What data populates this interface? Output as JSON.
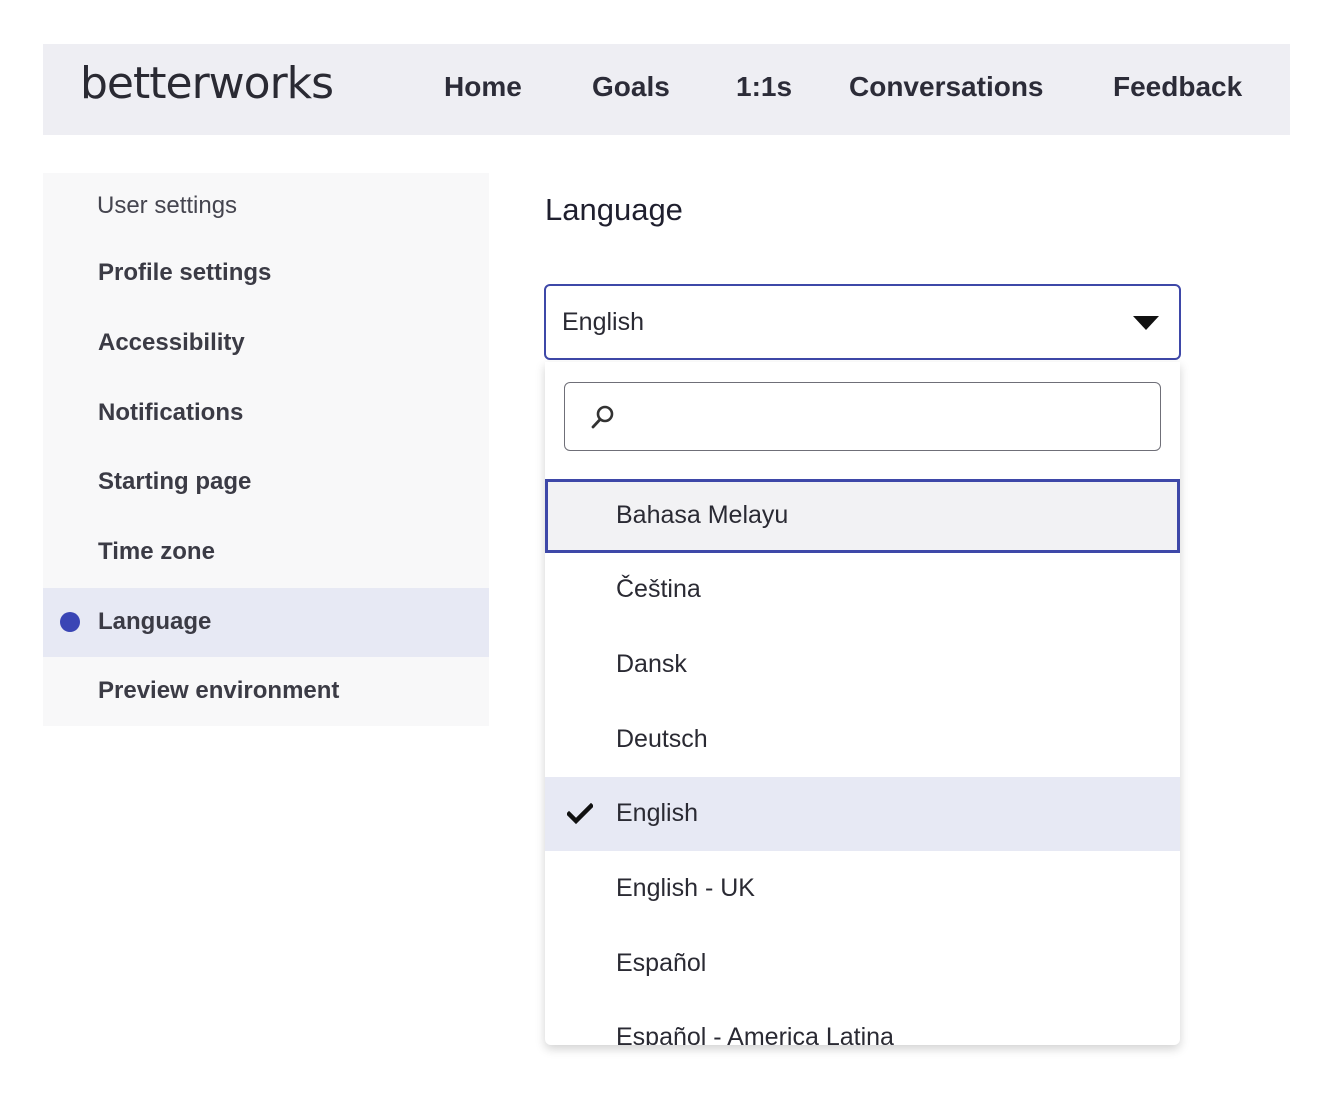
{
  "header": {
    "logo": "betterworks",
    "nav": [
      "Home",
      "Goals",
      "1:1s",
      "Conversations",
      "Feedback"
    ]
  },
  "sidebar": {
    "header": "User settings",
    "items": [
      {
        "label": "Profile settings",
        "active": false
      },
      {
        "label": "Accessibility",
        "active": false
      },
      {
        "label": "Notifications",
        "active": false
      },
      {
        "label": "Starting page",
        "active": false
      },
      {
        "label": "Time zone",
        "active": false
      },
      {
        "label": "Language",
        "active": true
      },
      {
        "label": "Preview environment",
        "active": false
      }
    ]
  },
  "main": {
    "title": "Language",
    "select": {
      "value": "English",
      "search_value": "",
      "options": [
        {
          "label": "Bahasa Melayu",
          "focused": true,
          "selected": false
        },
        {
          "label": "Čeština",
          "focused": false,
          "selected": false
        },
        {
          "label": "Dansk",
          "focused": false,
          "selected": false
        },
        {
          "label": "Deutsch",
          "focused": false,
          "selected": false
        },
        {
          "label": "English",
          "focused": false,
          "selected": true
        },
        {
          "label": "English - UK",
          "focused": false,
          "selected": false
        },
        {
          "label": "Español",
          "focused": false,
          "selected": false
        },
        {
          "label": "Español - America Latina",
          "focused": false,
          "selected": false
        }
      ]
    }
  },
  "colors": {
    "accent": "#3a45b5",
    "header_bg": "#eeeef3",
    "sidebar_bg": "#f8f8f9",
    "active_bg": "#e7e9f4"
  }
}
